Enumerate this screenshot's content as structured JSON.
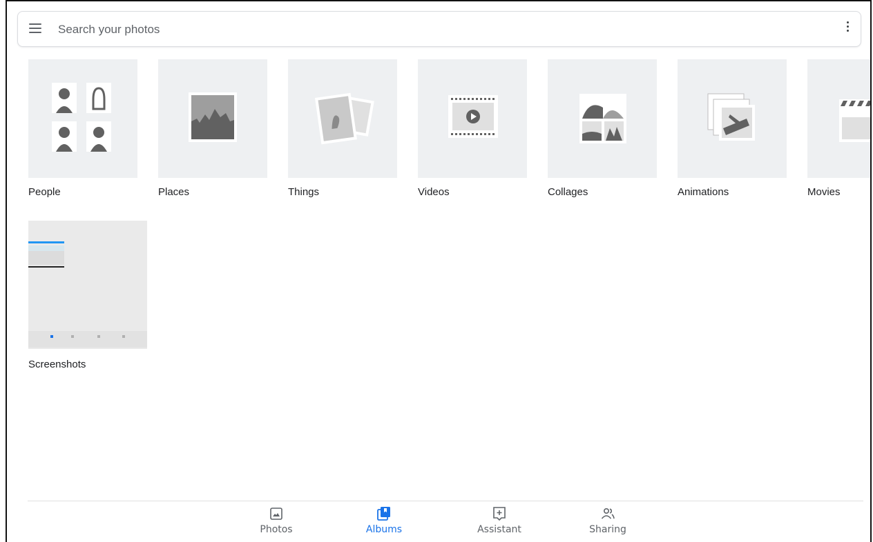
{
  "search": {
    "placeholder": "Search your photos"
  },
  "icons": {
    "menu": "menu-icon",
    "more": "more-vert-icon"
  },
  "albums": [
    {
      "label": "People",
      "icon": "people-icon"
    },
    {
      "label": "Places",
      "icon": "places-icon"
    },
    {
      "label": "Things",
      "icon": "things-icon"
    },
    {
      "label": "Videos",
      "icon": "videos-icon"
    },
    {
      "label": "Collages",
      "icon": "collages-icon"
    },
    {
      "label": "Animations",
      "icon": "animations-icon"
    },
    {
      "label": "Movies",
      "icon": "movies-icon"
    },
    {
      "label": "Screenshots",
      "icon": "screenshot-thumbnail"
    }
  ],
  "nav": [
    {
      "label": "Photos",
      "icon": "photo-icon",
      "active": false
    },
    {
      "label": "Albums",
      "icon": "albums-icon",
      "active": true
    },
    {
      "label": "Assistant",
      "icon": "assistant-icon",
      "active": false
    },
    {
      "label": "Sharing",
      "icon": "sharing-icon",
      "active": false
    }
  ],
  "colors": {
    "accent": "#1a73e8",
    "thumb_bg": "#eef0f2",
    "icon_gray": "#5f6368"
  }
}
